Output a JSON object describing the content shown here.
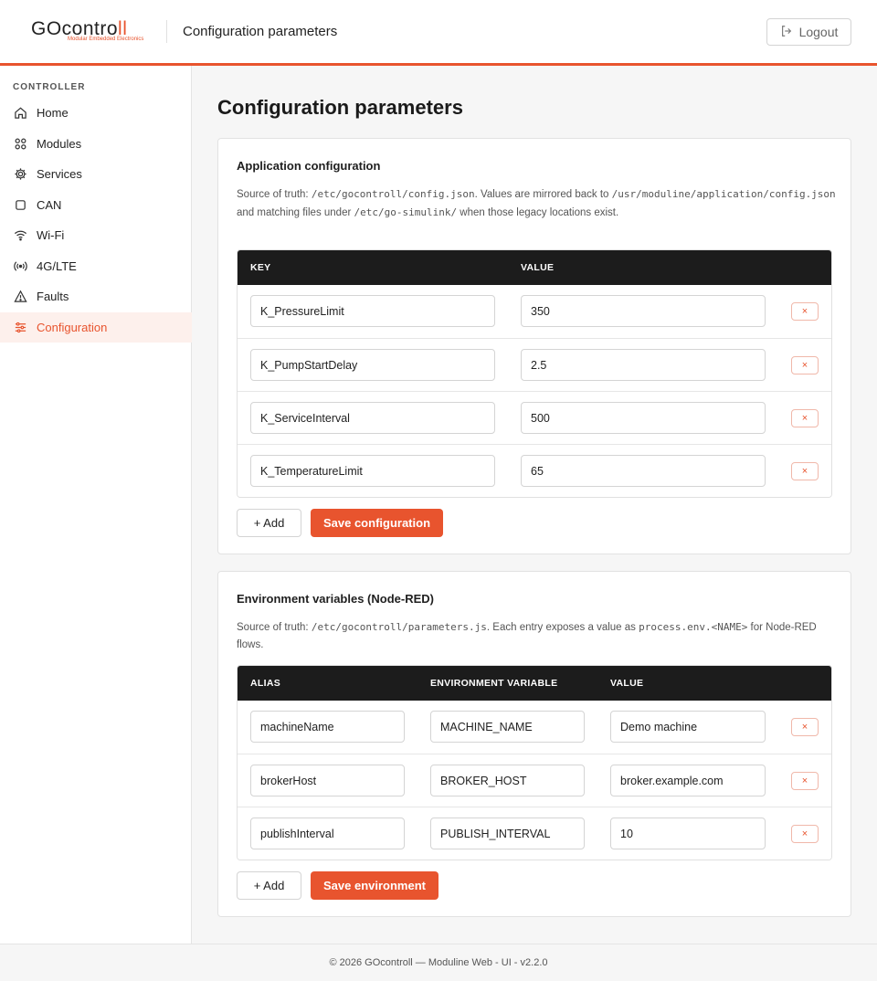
{
  "header": {
    "logo_main_go": "GO",
    "logo_main_contro": "contro",
    "logo_main_ll": "ll",
    "logo_tagline": "Modular Embedded Electronics",
    "title": "Configuration parameters",
    "logout_label": "Logout"
  },
  "sidebar": {
    "heading": "CONTROLLER",
    "items": [
      {
        "label": "Home",
        "icon": "home-icon"
      },
      {
        "label": "Modules",
        "icon": "modules-icon"
      },
      {
        "label": "Services",
        "icon": "gear-icon"
      },
      {
        "label": "CAN",
        "icon": "can-icon"
      },
      {
        "label": "Wi-Fi",
        "icon": "wifi-icon"
      },
      {
        "label": "4G/LTE",
        "icon": "signal-icon"
      },
      {
        "label": "Faults",
        "icon": "warning-icon"
      },
      {
        "label": "Configuration",
        "icon": "sliders-icon",
        "active": true
      }
    ]
  },
  "main": {
    "title": "Configuration parameters"
  },
  "app_config": {
    "title": "Application configuration",
    "desc_1": "Source of truth: ",
    "desc_path1": "/etc/gocontroll/config.json",
    "desc_2": ". Values are mirrored back to ",
    "desc_path2": "/usr/moduline/application/config.json",
    "desc_3": " and matching files under ",
    "desc_path3": "/etc/go-simulink/",
    "desc_4": " when those legacy locations exist.",
    "columns": [
      "KEY",
      "VALUE"
    ],
    "rows": [
      {
        "key": "K_PressureLimit",
        "value": "350"
      },
      {
        "key": "K_PumpStartDelay",
        "value": "2.5"
      },
      {
        "key": "K_ServiceInterval",
        "value": "500"
      },
      {
        "key": "K_TemperatureLimit",
        "value": "65"
      }
    ],
    "delete_label": "×",
    "add_label": "+ Add",
    "save_label": "Save configuration"
  },
  "env_vars": {
    "title": "Environment variables (Node-RED)",
    "desc_1": "Source of truth: ",
    "desc_path1": "/etc/gocontroll/parameters.js",
    "desc_2": ". Each entry exposes a value as ",
    "desc_path2": "process.env.<NAME>",
    "desc_3": " for Node-RED flows.",
    "columns": [
      "ALIAS",
      "ENVIRONMENT VARIABLE",
      "VALUE"
    ],
    "rows": [
      {
        "alias": "machineName",
        "env": "MACHINE_NAME",
        "value": "Demo machine"
      },
      {
        "alias": "brokerHost",
        "env": "BROKER_HOST",
        "value": "broker.example.com"
      },
      {
        "alias": "publishInterval",
        "env": "PUBLISH_INTERVAL",
        "value": "10"
      }
    ],
    "delete_label": "×",
    "add_label": "+ Add",
    "save_label": "Save environment"
  },
  "footer": {
    "text": "© 2026 GOcontroll — Moduline Web - UI - v2.2.0"
  },
  "colors": {
    "accent": "#e8542e",
    "table_header": "#1c1c1c"
  }
}
